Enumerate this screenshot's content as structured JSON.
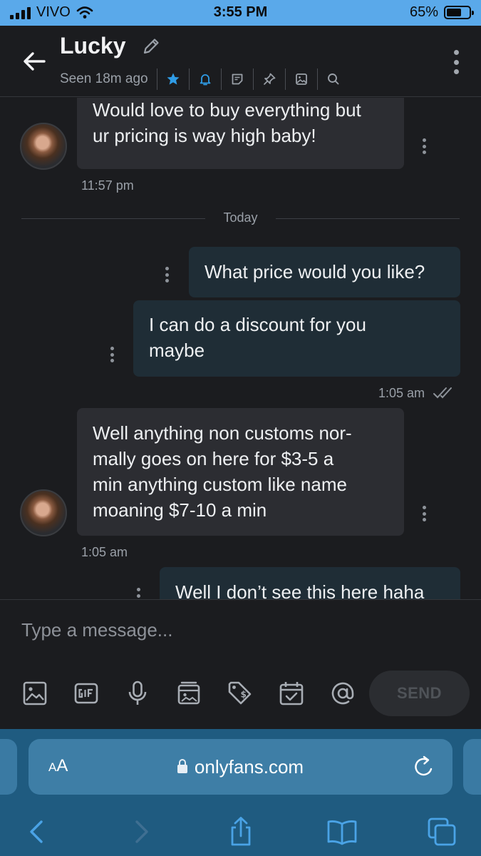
{
  "status_bar": {
    "carrier": "VIVO",
    "time": "3:55 PM",
    "battery_text": "65%",
    "battery_level": 0.65
  },
  "header": {
    "name": "Lucky",
    "seen": "Seen 18m ago",
    "toolbar_icons": [
      "star-icon",
      "bell-icon",
      "note-icon",
      "pin-icon",
      "image-icon",
      "search-icon"
    ]
  },
  "messages": [
    {
      "direction": "in",
      "lines": [
        "Would love to buy everything but",
        "ur pricing is way high baby!"
      ],
      "time": "11:57 pm"
    },
    {
      "divider": "Today"
    },
    {
      "direction": "out",
      "lines": [
        "What price would you like?"
      ]
    },
    {
      "direction": "out",
      "lines": [
        "I can do a discount for you",
        "maybe"
      ],
      "time": "1:05 am"
    },
    {
      "direction": "in",
      "lines": [
        "Well anything non customs nor-",
        "mally goes on here for $3-5 a",
        "min anything custom like name",
        "moaning $7-10 a min"
      ],
      "time": "1:05 am"
    },
    {
      "direction": "out",
      "lines": [
        "Well I don’t see this here haha"
      ]
    }
  ],
  "composer": {
    "placeholder": "Type a message...",
    "send_label": "SEND",
    "tools": [
      "image-icon",
      "gif-icon",
      "microphone-icon",
      "vault-icon",
      "price-tag-icon",
      "calendar-icon",
      "mention-icon"
    ]
  },
  "browser": {
    "aa_small": "A",
    "aa_large": "A",
    "url": "onlyfans.com"
  },
  "colors": {
    "accent": "#2f9ce6",
    "status_bar": "#5aa9ea",
    "background": "#1b1c1f",
    "browser_chrome": "#1f5b80"
  }
}
